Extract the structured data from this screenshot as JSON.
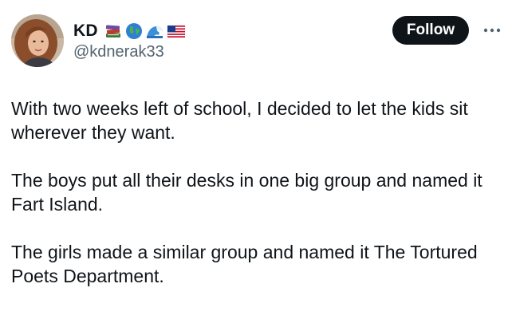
{
  "author": {
    "display_name": "KD",
    "handle": "@kdnerak33",
    "name_emojis": [
      "books-emoji",
      "globe-emoji",
      "wave-emoji",
      "us-flag-emoji"
    ]
  },
  "actions": {
    "follow_label": "Follow"
  },
  "tweet": {
    "paragraphs": [
      "With two weeks left of school, I decided to let the kids sit wherever they want.",
      "The boys put all their desks in one big group and named it Fart Island.",
      "The girls made a similar group and named it The Tortured Poets Department."
    ]
  },
  "colors": {
    "text_primary": "#0f1419",
    "text_secondary": "#536471",
    "button_bg": "#0f1419",
    "button_text": "#ffffff",
    "background": "#ffffff"
  }
}
